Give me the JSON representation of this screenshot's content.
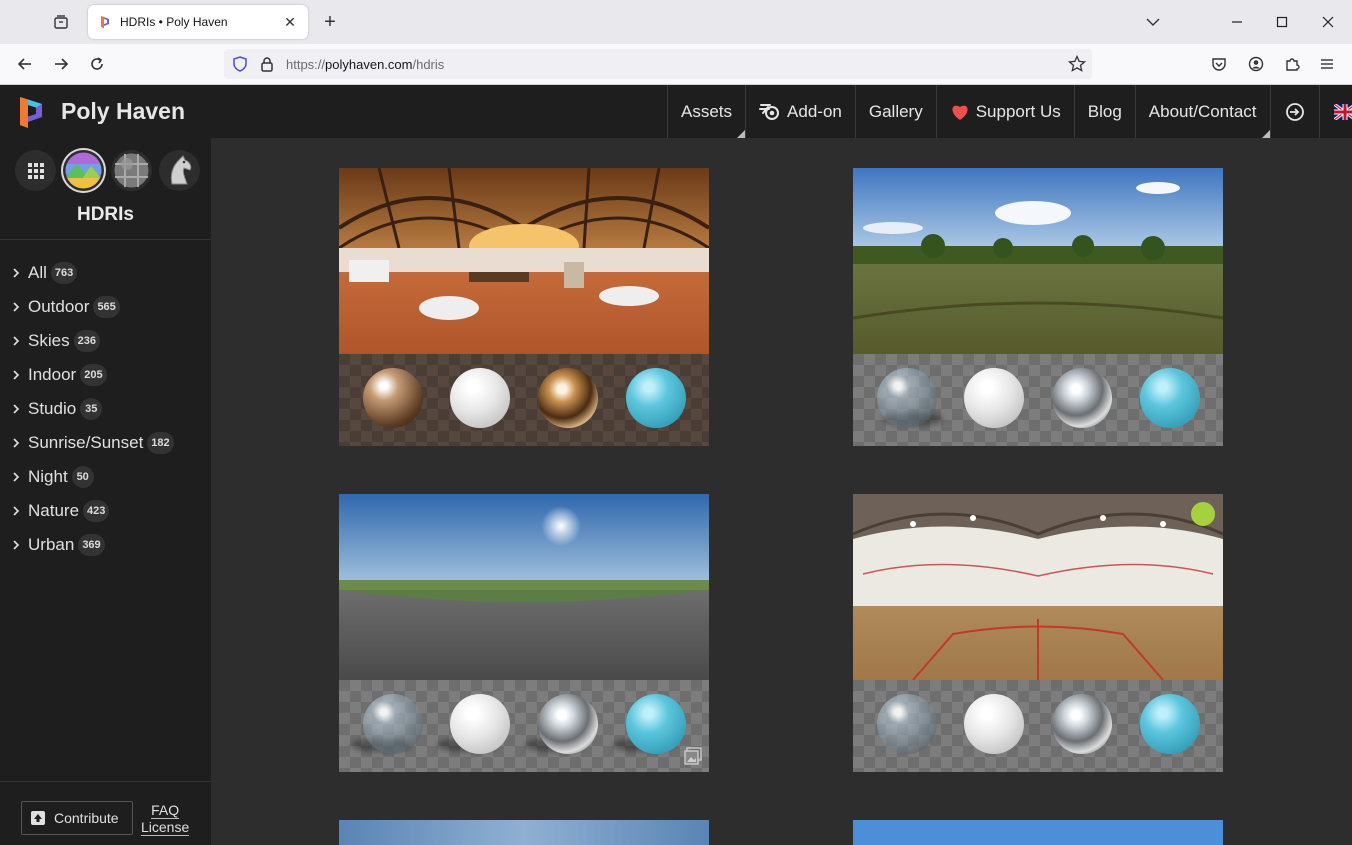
{
  "browser": {
    "tab_title": "HDRIs • Poly Haven",
    "url_prefix": "https://",
    "url_host": "polyhaven.com",
    "url_path": "/hdris"
  },
  "site": {
    "name": "Poly Haven",
    "menu": [
      {
        "label": "Assets",
        "icon": "",
        "dropdown": true
      },
      {
        "label": "Add-on",
        "icon": "blender-icon",
        "dropdown": false
      },
      {
        "label": "Gallery",
        "icon": "",
        "dropdown": false
      },
      {
        "label": "Support Us",
        "icon": "heart-icon",
        "dropdown": false
      },
      {
        "label": "Blog",
        "icon": "",
        "dropdown": false
      },
      {
        "label": "About/Contact",
        "icon": "",
        "dropdown": true
      }
    ]
  },
  "sidebar": {
    "title": "HDRIs",
    "categories": [
      {
        "name": "All",
        "count": "763"
      },
      {
        "name": "Outdoor",
        "count": "565"
      },
      {
        "name": "Skies",
        "count": "236"
      },
      {
        "name": "Indoor",
        "count": "205"
      },
      {
        "name": "Studio",
        "count": "35"
      },
      {
        "name": "Sunrise/Sunset",
        "count": "182"
      },
      {
        "name": "Night",
        "count": "50"
      },
      {
        "name": "Nature",
        "count": "423"
      },
      {
        "name": "Urban",
        "count": "369"
      }
    ],
    "contribute_label": "Contribute",
    "faq_label": "FAQ",
    "license_label": "License"
  },
  "colors": {
    "accent_green": "#a6d13f",
    "heart_red": "#ef4e4e"
  }
}
